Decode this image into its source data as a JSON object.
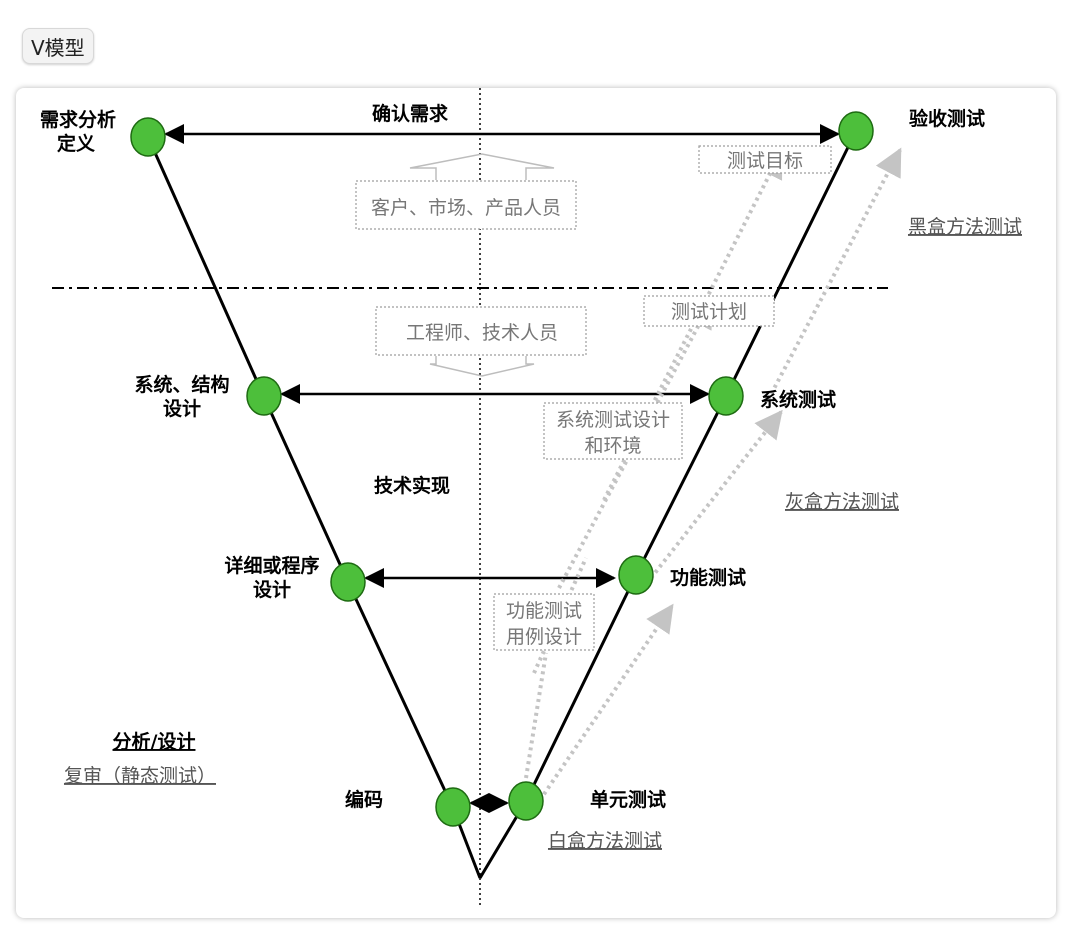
{
  "header": {
    "tag": "V模型"
  },
  "diagram": {
    "left_nodes": {
      "requirements": [
        "需求分析",
        "定义"
      ],
      "system_design": [
        "系统、结构",
        "设计"
      ],
      "detailed_design": [
        "详细或程序",
        "设计"
      ],
      "coding": "编码"
    },
    "right_nodes": {
      "acceptance": "验收测试",
      "system_test": "系统测试",
      "function_test": "功能测试",
      "unit_test": "单元测试"
    },
    "center": {
      "confirm": "确认需求",
      "stakeholders": "客户、市场、产品人员",
      "engineers": "工程师、技术人员",
      "implementation": "技术实现"
    },
    "boxes": {
      "test_goal": "测试目标",
      "test_plan": "测试计划",
      "system_test_design": [
        "系统测试设计",
        "和环境"
      ],
      "function_test_case": [
        "功能测试",
        "用例设计"
      ]
    },
    "methods": {
      "black_box": "黑盒方法测试",
      "gray_box": "灰盒方法测试",
      "white_box": "白盒方法测试"
    },
    "review": {
      "title": "分析/设计",
      "subtitle": "复审（静态测试）"
    },
    "colors": {
      "node": "#4dbf3b",
      "node_stroke": "#1e6b12",
      "line": "#000000",
      "dotted": "#bbbbbb"
    }
  }
}
